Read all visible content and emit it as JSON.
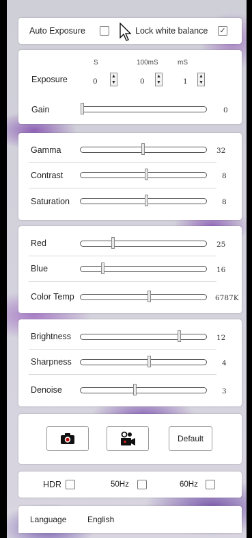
{
  "top": {
    "auto_exposure_label": "Auto Exposure",
    "auto_exposure_checked": false,
    "lock_wb_label": "Lock white balance",
    "lock_wb_checked": true
  },
  "exposure": {
    "label": "Exposure",
    "units": [
      "S",
      "100mS",
      "mS"
    ],
    "values": [
      "0",
      "0",
      "1"
    ],
    "gain_label": "Gain",
    "gain_value": "0"
  },
  "tone": [
    {
      "label": "Gamma",
      "value": "32",
      "level": 0.5
    },
    {
      "label": "Contrast",
      "value": "8",
      "level": 0.53
    },
    {
      "label": "Saturation",
      "value": "8",
      "level": 0.53
    }
  ],
  "color": [
    {
      "label": "Red",
      "value": "25",
      "level": 0.25
    },
    {
      "label": "Blue",
      "value": "16",
      "level": 0.17
    },
    {
      "label": "Color Temp",
      "value": "6787K",
      "level": 0.55
    }
  ],
  "image": [
    {
      "label": "Brightness",
      "value": "12",
      "level": 0.8
    },
    {
      "label": "Sharpness",
      "value": "4",
      "level": 0.55
    },
    {
      "label": "Denoise",
      "value": "3",
      "level": 0.43
    }
  ],
  "actions": {
    "snapshot_icon": "camera-icon",
    "record_icon": "video-camera-icon",
    "default_label": "Default"
  },
  "flicker": {
    "hdr_label": "HDR",
    "hz50_label": "50Hz",
    "hz60_label": "60Hz",
    "hdr_checked": false,
    "hz50_checked": false,
    "hz60_checked": false
  },
  "language": {
    "label": "Language",
    "value": "English"
  }
}
